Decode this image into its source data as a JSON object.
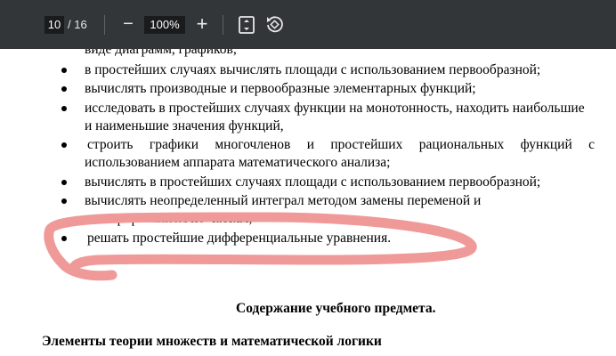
{
  "toolbar": {
    "current_page": "10",
    "page_total": "/ 16",
    "zoom_minus": "−",
    "zoom_value": "100%",
    "zoom_plus": "+",
    "fit_icon": "fit-to-page-icon",
    "rotate_icon": "rotate-icon"
  },
  "document": {
    "partial_top_line": "виде диаграмм, графиков;",
    "bullets": [
      {
        "lines": [
          "в простейших случаях вычислять площади с использованием первообразной;"
        ]
      },
      {
        "lines": [
          "вычислять производные и первообразные элементарных функций;"
        ]
      },
      {
        "lines": [
          "исследовать в простейших случаях функции на монотонность, находить наибольшие",
          "и наименьшие значения функций,"
        ]
      },
      {
        "lines": [
          "строить графики многочленов и простейших рациональных функций с",
          "использованием аппарата математического анализа;"
        ]
      },
      {
        "lines": [
          "вычислять в простейших случаях площади с использованием первообразной;"
        ]
      },
      {
        "lines": [
          "вычислять неопределенный интеграл методом замены переменой и",
          "интегрированием по частям;"
        ]
      },
      {
        "lines": [
          "решать простейшие дифференциальные уравнения."
        ]
      }
    ],
    "section_title": "Содержание учебного предмета.",
    "subsection_title": "Элементы теории множеств и математической логики"
  },
  "annotation": {
    "color": "#ef9a98"
  }
}
